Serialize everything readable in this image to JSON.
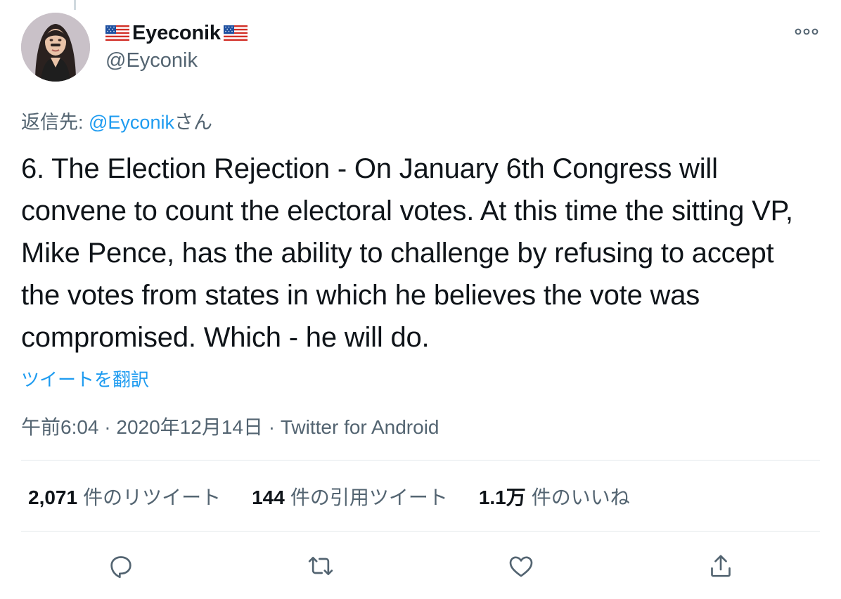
{
  "author": {
    "display_name": "Eyeconik",
    "handle": "@Eyconik"
  },
  "reply_to": {
    "prefix": "返信先: ",
    "mention": "@Eyconik",
    "suffix": "さん"
  },
  "tweet": {
    "text": "6. The Election Rejection - On January 6th Congress will convene to count the electoral votes. At this time the sitting VP, Mike Pence, has the ability to challenge by refusing to accept the votes from states in which he believes the vote was compromised. Which - he will do.",
    "translate_label": "ツイートを翻訳",
    "timestamp": "午前6:04 · 2020年12月14日 · Twitter for Android"
  },
  "stats": {
    "retweets": {
      "count": "2,071",
      "label": "件のリツイート"
    },
    "quotes": {
      "count": "144",
      "label": "件の引用ツイート"
    },
    "likes": {
      "count": "1.1万",
      "label": "件のいいね"
    }
  },
  "icons": {
    "more": "more-horizontal-icon",
    "reply": "reply-bubble-icon",
    "retweet": "retweet-icon",
    "like": "heart-icon",
    "share": "share-upload-icon",
    "flag": "us-flag-emoji"
  },
  "colors": {
    "text": "#0f1419",
    "secondary": "#536471",
    "accent": "#1d9bf0",
    "divider": "#e3e8eb"
  }
}
